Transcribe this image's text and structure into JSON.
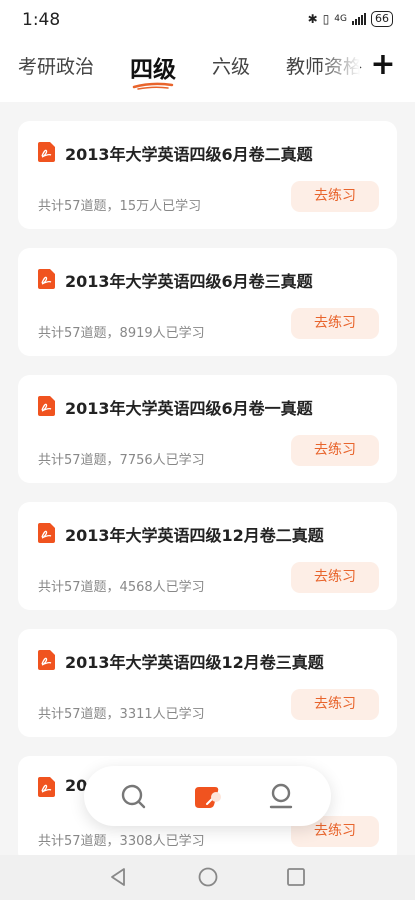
{
  "status_bar": {
    "time": "1:48",
    "network": "4G",
    "battery": "66"
  },
  "tabs": [
    {
      "label": "考研政治",
      "active": false
    },
    {
      "label": "四级",
      "active": true
    },
    {
      "label": "六级",
      "active": false
    },
    {
      "label": "教师资格",
      "active": false
    }
  ],
  "add_label": "+",
  "cards": [
    {
      "title": "2013年大学英语四级6月卷二真题",
      "meta": "共计57道题，15万人已学习",
      "button": "去练习"
    },
    {
      "title": "2013年大学英语四级6月卷三真题",
      "meta": "共计57道题，8919人已学习",
      "button": "去练习"
    },
    {
      "title": "2013年大学英语四级6月卷一真题",
      "meta": "共计57道题，7756人已学习",
      "button": "去练习"
    },
    {
      "title": "2013年大学英语四级12月卷二真题",
      "meta": "共计57道题，4568人已学习",
      "button": "去练习"
    },
    {
      "title": "2013年大学英语四级12月卷三真题",
      "meta": "共计57道题，3311人已学习",
      "button": "去练习"
    },
    {
      "title": "20",
      "meta": "共计57道题，3308人已学习",
      "button": "去练习"
    }
  ],
  "nav": {
    "items": [
      "search-icon",
      "practice-icon",
      "profile-icon"
    ]
  },
  "colors": {
    "accent": "#e8642c",
    "accent_light": "#fdeee6",
    "pdf_red": "#f0531f"
  }
}
